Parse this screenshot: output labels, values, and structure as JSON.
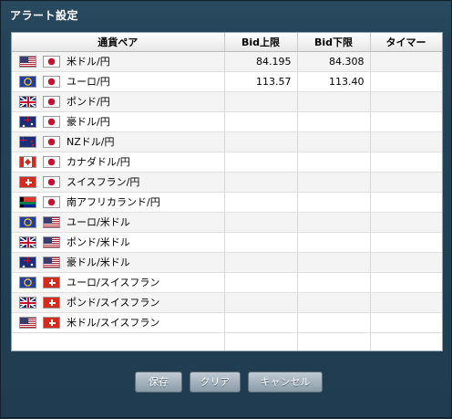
{
  "window": {
    "title": "アラート設定"
  },
  "table": {
    "columns": [
      "通貨ペア",
      "Bid上限",
      "Bid下限",
      "タイマー"
    ],
    "rows": [
      {
        "pair": "米ドル/円",
        "flags": [
          "us-flag-icon",
          "jp-flag-icon"
        ],
        "bid_upper": "84.195",
        "bid_lower": "84.308",
        "timer": ""
      },
      {
        "pair": "ユーロ/円",
        "flags": [
          "eu-flag-icon",
          "jp-flag-icon"
        ],
        "bid_upper": "113.57",
        "bid_lower": "113.40",
        "timer": ""
      },
      {
        "pair": "ポンド/円",
        "flags": [
          "gb-flag-icon",
          "jp-flag-icon"
        ],
        "bid_upper": "",
        "bid_lower": "",
        "timer": ""
      },
      {
        "pair": "豪ドル/円",
        "flags": [
          "au-flag-icon",
          "jp-flag-icon"
        ],
        "bid_upper": "",
        "bid_lower": "",
        "timer": ""
      },
      {
        "pair": "NZドル/円",
        "flags": [
          "nz-flag-icon",
          "jp-flag-icon"
        ],
        "bid_upper": "",
        "bid_lower": "",
        "timer": ""
      },
      {
        "pair": "カナダドル/円",
        "flags": [
          "ca-flag-icon",
          "jp-flag-icon"
        ],
        "bid_upper": "",
        "bid_lower": "",
        "timer": ""
      },
      {
        "pair": "スイスフラン/円",
        "flags": [
          "ch-flag-icon",
          "jp-flag-icon"
        ],
        "bid_upper": "",
        "bid_lower": "",
        "timer": ""
      },
      {
        "pair": "南アフリカランド/円",
        "flags": [
          "za-flag-icon",
          "jp-flag-icon"
        ],
        "bid_upper": "",
        "bid_lower": "",
        "timer": ""
      },
      {
        "pair": "ユーロ/米ドル",
        "flags": [
          "eu-flag-icon",
          "us-flag-icon"
        ],
        "bid_upper": "",
        "bid_lower": "",
        "timer": ""
      },
      {
        "pair": "ポンド/米ドル",
        "flags": [
          "gb-flag-icon",
          "us-flag-icon"
        ],
        "bid_upper": "",
        "bid_lower": "",
        "timer": ""
      },
      {
        "pair": "豪ドル/米ドル",
        "flags": [
          "au-flag-icon",
          "us-flag-icon"
        ],
        "bid_upper": "",
        "bid_lower": "",
        "timer": ""
      },
      {
        "pair": "ユーロ/スイスフラン",
        "flags": [
          "eu-flag-icon",
          "ch-flag-icon"
        ],
        "bid_upper": "",
        "bid_lower": "",
        "timer": ""
      },
      {
        "pair": "ポンド/スイスフラン",
        "flags": [
          "gb-flag-icon",
          "ch-flag-icon"
        ],
        "bid_upper": "",
        "bid_lower": "",
        "timer": ""
      },
      {
        "pair": "米ドル/スイスフラン",
        "flags": [
          "us-flag-icon",
          "ch-flag-icon"
        ],
        "bid_upper": "",
        "bid_lower": "",
        "timer": ""
      }
    ]
  },
  "buttons": {
    "save": "保存",
    "clear": "クリア",
    "cancel": "キャンセル"
  },
  "colors": {
    "window_bg": "#24445a",
    "header_text": "#ffffff",
    "button_bg": "#9aaab7"
  }
}
